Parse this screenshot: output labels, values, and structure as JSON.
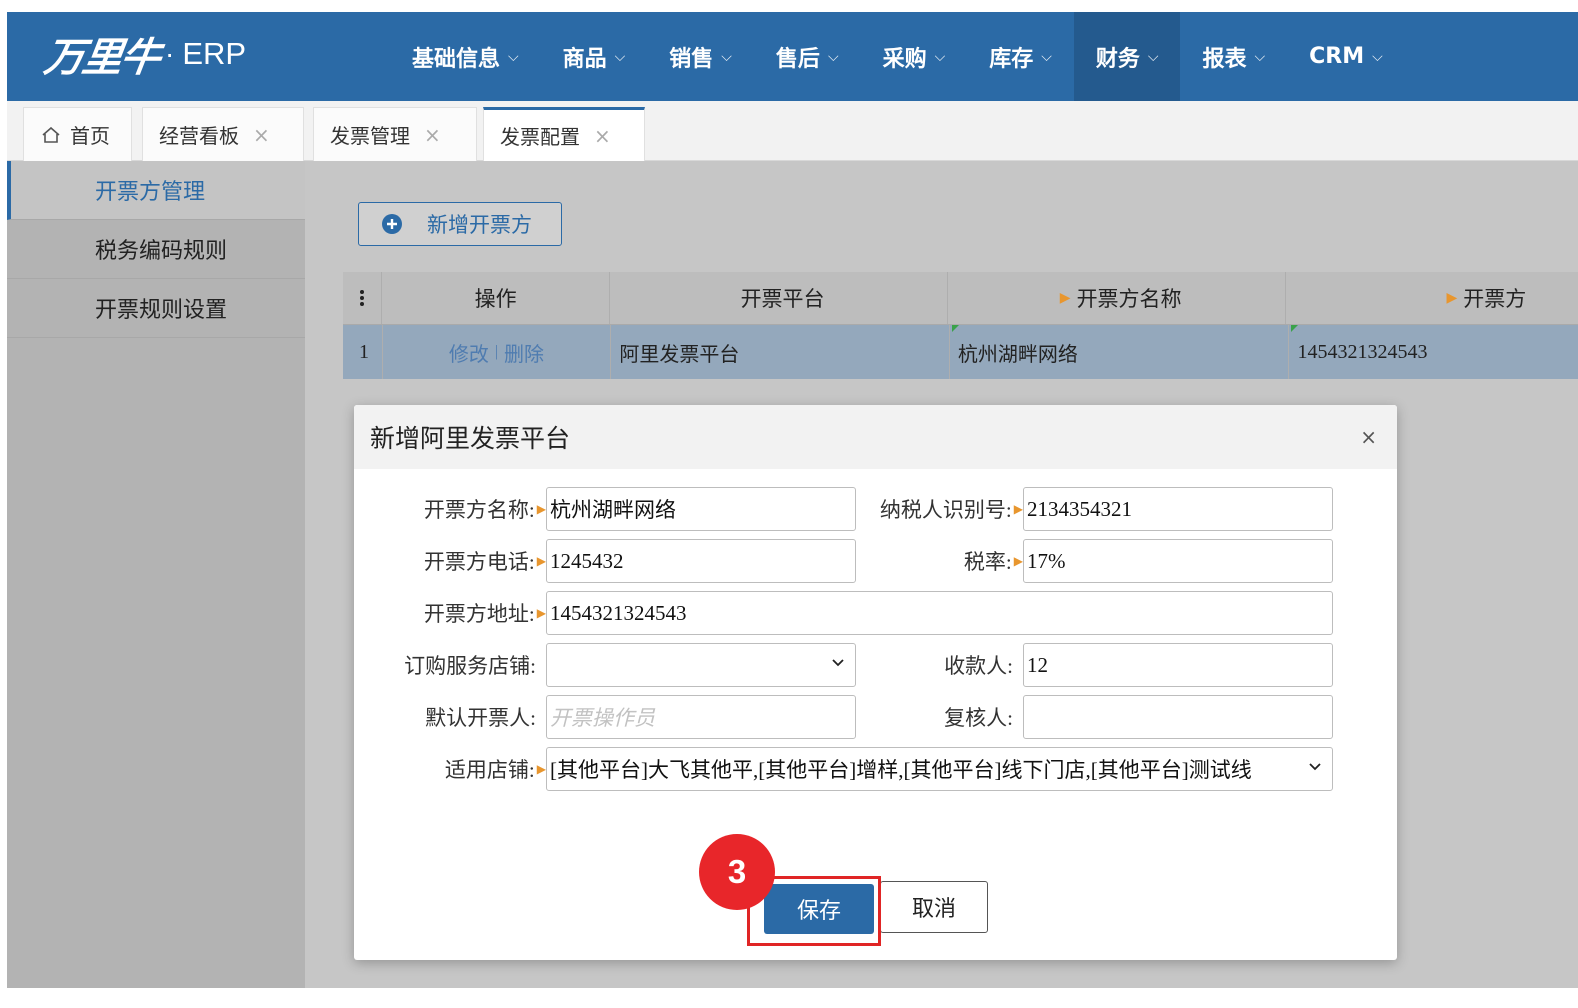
{
  "brand": {
    "logo_text": "万里牛",
    "product": "ERP"
  },
  "nav": {
    "items": [
      {
        "label": "基础信息"
      },
      {
        "label": "商品"
      },
      {
        "label": "销售"
      },
      {
        "label": "售后"
      },
      {
        "label": "采购"
      },
      {
        "label": "库存"
      },
      {
        "label": "财务",
        "active": true
      },
      {
        "label": "报表"
      },
      {
        "label": "CRM"
      }
    ]
  },
  "tabs": [
    {
      "label": "首页",
      "closable": false
    },
    {
      "label": "经营看板",
      "closable": true
    },
    {
      "label": "发票管理",
      "closable": true
    },
    {
      "label": "发票配置",
      "closable": true,
      "active": true
    }
  ],
  "sidebar": {
    "items": [
      {
        "label": "开票方管理",
        "active": true
      },
      {
        "label": "税务编码规则"
      },
      {
        "label": "开票规则设置"
      }
    ]
  },
  "main": {
    "add_button": "新增开票方",
    "grid": {
      "headers": [
        "操作",
        "开票平台",
        "开票方名称",
        "开票方"
      ],
      "rows": [
        {
          "index": "1",
          "edit": "修改",
          "delete": "删除",
          "separator": "|",
          "platform": "阿里发票平台",
          "name": "杭州湖畔网络",
          "extra": "1454321324543"
        }
      ]
    }
  },
  "modal": {
    "title": "新增阿里发票平台",
    "close": "×",
    "fields": {
      "issuer_name": {
        "label": "开票方名称:",
        "value": "杭州湖畔网络"
      },
      "tax_id": {
        "label": "纳税人识别号:",
        "value": "2134354321"
      },
      "phone": {
        "label": "开票方电话:",
        "value": "1245432"
      },
      "tax_rate": {
        "label": "税率:",
        "value": "17%"
      },
      "address": {
        "label": "开票方地址:",
        "value": "1454321324543"
      },
      "order_shop": {
        "label": "订购服务店铺:",
        "value": ""
      },
      "payee": {
        "label": "收款人:",
        "value": "12"
      },
      "default_issuer": {
        "label": "默认开票人:",
        "placeholder": "开票操作员"
      },
      "reviewer": {
        "label": "复核人:",
        "value": ""
      },
      "shops": {
        "label": "适用店铺:",
        "value": "[其他平台]大飞其他平,[其他平台]增样,[其他平台]线下门店,[其他平台]测试线"
      }
    },
    "save_label": "保存",
    "cancel_label": "取消"
  },
  "annotation": {
    "step": "3"
  },
  "colors": {
    "brand_blue": "#2b6aa6",
    "highlight_red": "#e02525",
    "badge_red": "#e8262a",
    "required_marker": "#e8962e"
  }
}
